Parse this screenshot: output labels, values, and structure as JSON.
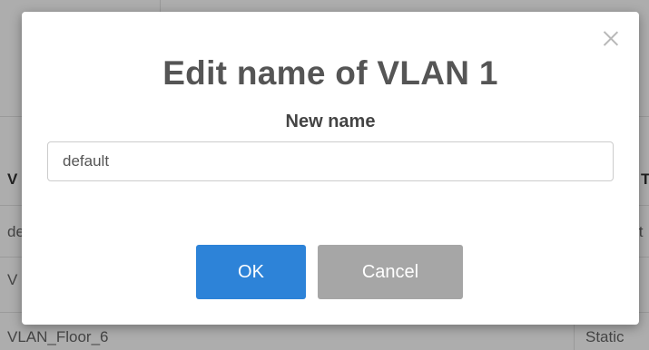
{
  "background_table": {
    "header_first_col": "V",
    "header_last_col": "T",
    "row1_first": "de",
    "row1_last": "lt",
    "row2_first": "V",
    "row3_first": "VLAN_Floor_6",
    "row3_last": "Static"
  },
  "dialog": {
    "title": "Edit name of VLAN 1",
    "field_label": "New name",
    "input_value": "default",
    "ok_label": "OK",
    "cancel_label": "Cancel",
    "close_icon": "close-icon"
  },
  "colors": {
    "ok_button": "#2d83d8",
    "cancel_button": "#a6a6a6",
    "title_text": "#555555"
  }
}
